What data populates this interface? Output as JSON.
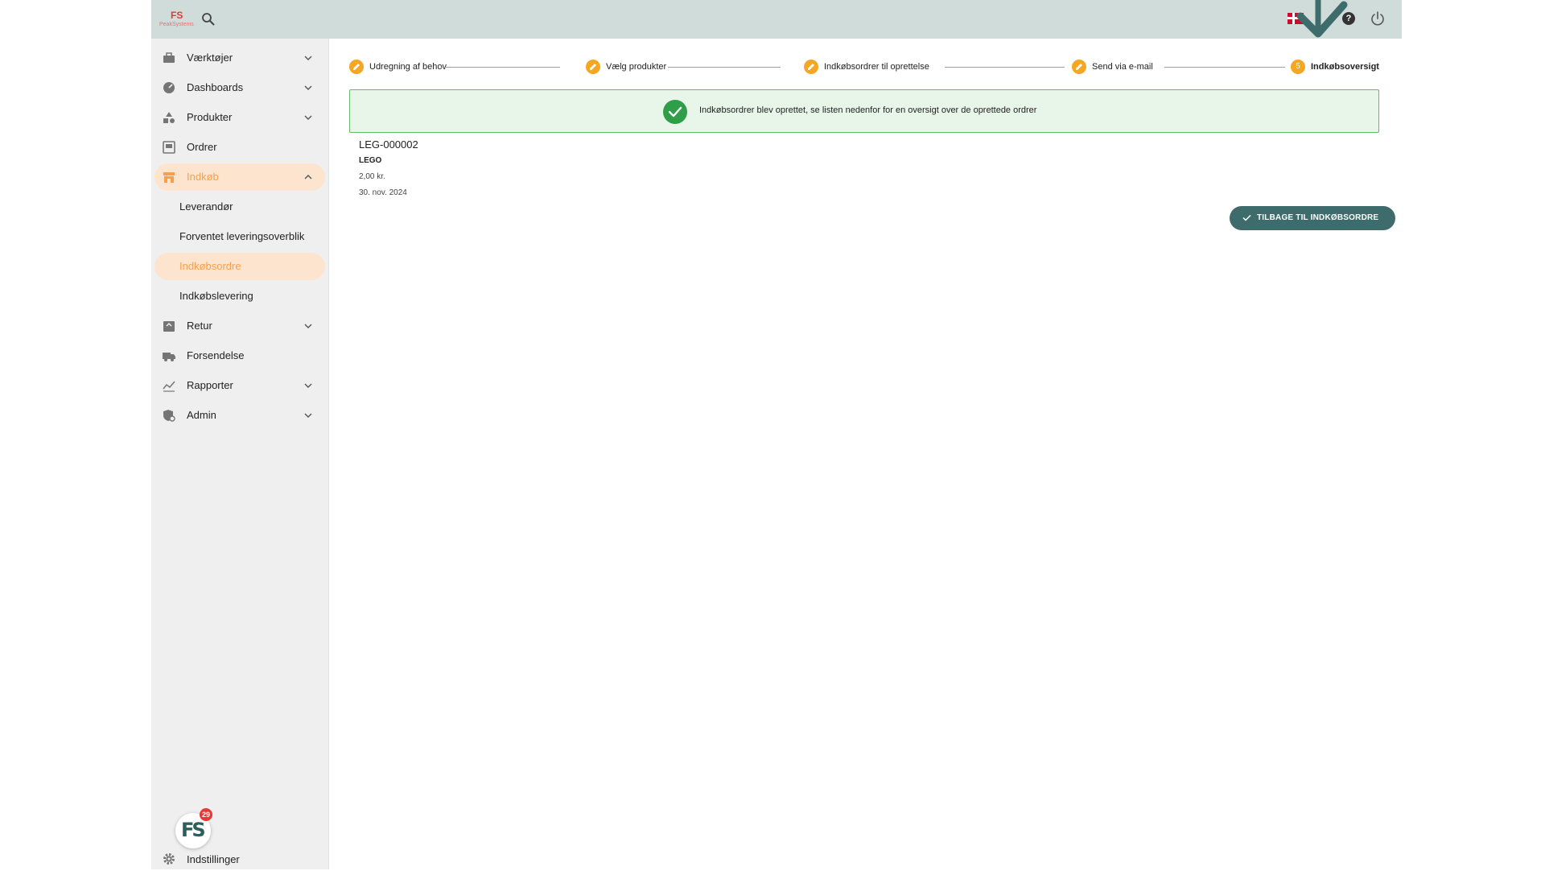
{
  "app": {
    "logo_text": "FS",
    "logo_subtext": "PeakSystems"
  },
  "header": {
    "icons": [
      "search-icon",
      "danish-flag-icon",
      "check-icon",
      "help-icon",
      "power-icon"
    ],
    "help_glyph": "?"
  },
  "sidebar": {
    "items": [
      {
        "label": "Værktøjer",
        "icon": "toolbox-icon",
        "expandable": true
      },
      {
        "label": "Dashboards",
        "icon": "gauge-icon",
        "expandable": true
      },
      {
        "label": "Produkter",
        "icon": "shapes-icon",
        "expandable": true
      },
      {
        "label": "Ordrer",
        "icon": "inbox-icon",
        "expandable": false
      },
      {
        "label": "Indkøb",
        "icon": "store-icon",
        "expandable": true,
        "expanded": true,
        "active": true
      },
      {
        "label": "Retur",
        "icon": "return-box-icon",
        "expandable": true
      },
      {
        "label": "Forsendelse",
        "icon": "truck-icon",
        "expandable": false
      },
      {
        "label": "Rapporter",
        "icon": "chart-icon",
        "expandable": true
      },
      {
        "label": "Admin",
        "icon": "admin-shield-icon",
        "expandable": true
      }
    ],
    "subitems": [
      {
        "label": "Leverandør"
      },
      {
        "label": "Forventet leveringsoverblik"
      },
      {
        "label": "Indkøbsordre",
        "active": true
      },
      {
        "label": "Indkøbslevering"
      }
    ],
    "badge_count": "29",
    "badge_logo": "FS",
    "settings_label": "Indstillinger"
  },
  "stepper": {
    "steps": [
      {
        "label": "Udregning af behov",
        "state": "done"
      },
      {
        "label": "Vælg produkter",
        "state": "done"
      },
      {
        "label": "Indkøbsordrer til oprettelse",
        "state": "done"
      },
      {
        "label": "Send via e-mail",
        "state": "done"
      },
      {
        "label": "Indkøbsoversigt",
        "state": "current",
        "number": "5"
      }
    ]
  },
  "alert": {
    "message": "Indkøbsordrer blev oprettet, se listen nedenfor for en oversigt over de oprettede ordrer"
  },
  "order": {
    "id": "LEG-000002",
    "vendor": "LEGO",
    "amount": "2,00 kr.",
    "date": "30. nov. 2024"
  },
  "actions": {
    "back_label": "TILBAGE TIL INDKØBSORDRE"
  },
  "colors": {
    "accent": "#f5a623",
    "active_bg": "#fde4cf",
    "active_text": "#f5a04e",
    "success": "#2e9e48",
    "success_bg": "#e8f5e9",
    "primary_button": "#3e6b6b",
    "topbar": "#d0dcda",
    "sidebar": "#efefef"
  }
}
